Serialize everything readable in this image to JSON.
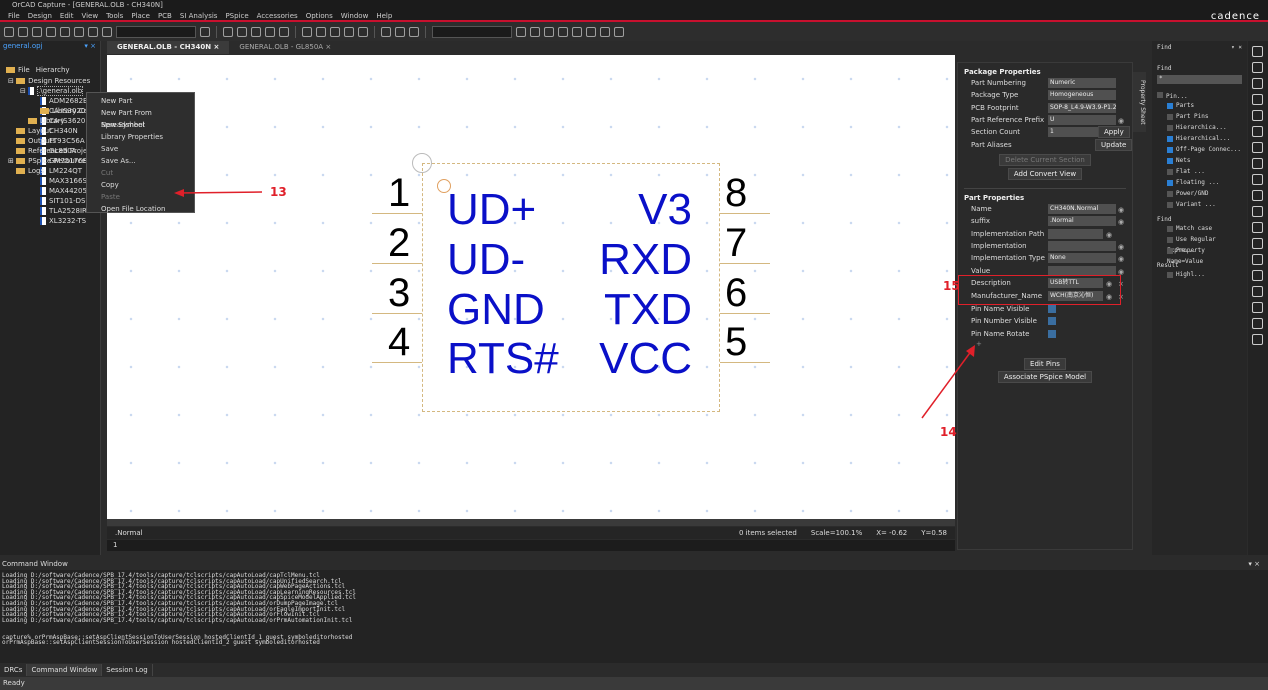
{
  "window": {
    "title": "OrCAD Capture - [GENERAL.OLB - CH340N]",
    "brand": "cadence"
  },
  "menu": [
    "File",
    "Design",
    "Edit",
    "View",
    "Tools",
    "Place",
    "PCB",
    "SI Analysis",
    "PSpice",
    "Accessories",
    "Options",
    "Window",
    "Help"
  ],
  "project_panel": {
    "title": "general.opj",
    "tabs": [
      "File",
      "Hierarchy"
    ],
    "tree": {
      "design_resources": "Design Resources",
      "library_file": ".\\general.olb",
      "parts": [
        "ADM2682EI",
        "CA-IS3020S",
        "CA-IS3620L",
        "CH340N",
        "FT93C56A",
        "GL850A",
        "GM75176E",
        "LM224QT",
        "MAX3166S",
        "MAX44205I",
        "SIT101-DS-",
        "TLA2528IRT",
        "XL3232-TS"
      ],
      "library_cache": "Library Cache",
      "library": "Library",
      "others": [
        "Layout",
        "Outputs",
        "Referenced Projects",
        "PSpice Resources",
        "Logs"
      ]
    }
  },
  "context_menu": {
    "items": [
      {
        "label": "New Part",
        "enabled": true
      },
      {
        "label": "New Part From Spreadsheet",
        "enabled": true
      },
      {
        "label": "New Symbol",
        "enabled": true
      },
      {
        "label": "Library Properties",
        "enabled": true
      },
      {
        "label": "Save",
        "enabled": true
      },
      {
        "label": "Save As...",
        "enabled": true
      },
      {
        "label": "Cut",
        "enabled": false
      },
      {
        "label": "Copy",
        "enabled": true
      },
      {
        "label": "Paste",
        "enabled": false
      },
      {
        "label": "Open File Location",
        "enabled": true
      }
    ]
  },
  "doc_tabs": [
    {
      "label": "GENERAL.OLB - CH340N",
      "active": true
    },
    {
      "label": "GENERAL.OLB - GL850A",
      "active": false
    }
  ],
  "symbol": {
    "left_pins": [
      {
        "num": "1",
        "name": "UD+"
      },
      {
        "num": "2",
        "name": "UD-"
      },
      {
        "num": "3",
        "name": "GND"
      },
      {
        "num": "4",
        "name": "RTS#"
      }
    ],
    "right_pins": [
      {
        "num": "8",
        "name": "V3"
      },
      {
        "num": "7",
        "name": "RXD"
      },
      {
        "num": "6",
        "name": "TXD"
      },
      {
        "num": "5",
        "name": "VCC"
      }
    ]
  },
  "canvas_status": {
    "left": ".Normal",
    "selected": "0 items selected",
    "scale": "Scale=100.1%",
    "x": "X= -0.62",
    "y": "Y=0.58",
    "cmd": "1"
  },
  "property_sheet": {
    "tab": "Property Sheet",
    "package_title": "Package Properties",
    "package": [
      {
        "label": "Part Numbering",
        "value": "Numeric"
      },
      {
        "label": "Package Type",
        "value": "Homogeneous"
      },
      {
        "label": "PCB Footprint",
        "value": "SOP-8_L4.9-W3.9-P1.27-LS6."
      },
      {
        "label": "Part Reference Prefix",
        "value": "U"
      },
      {
        "label": "Section Count",
        "value": "1"
      },
      {
        "label": "Part Aliases",
        "value": ""
      }
    ],
    "apply": "Apply",
    "update": "Update",
    "delete_section": "Delete Current Section",
    "add_convert": "Add Convert View",
    "part_title": "Part Properties",
    "part": [
      {
        "label": "Name",
        "value": "CH340N.Normal"
      },
      {
        "label": "suffix",
        "value": ".Normal"
      },
      {
        "label": "Implementation Path",
        "value": ""
      },
      {
        "label": "Implementation",
        "value": ""
      },
      {
        "label": "Implementation Type",
        "value": "None"
      },
      {
        "label": "Value",
        "value": ""
      },
      {
        "label": "Description",
        "value": "USB转TTL"
      },
      {
        "label": "Manufacturer_Name",
        "value": "WCH(南京沁恒)"
      }
    ],
    "checks": [
      {
        "label": "Pin Name Visible",
        "checked": true
      },
      {
        "label": "Pin Number Visible",
        "checked": true
      },
      {
        "label": "Pin Name Rotate",
        "checked": true
      }
    ],
    "add_icon": "plus-icon",
    "edit_pins": "Edit Pins",
    "assoc_pspice": "Associate PSpice Model"
  },
  "find": {
    "title": "Find",
    "find_label": "Find",
    "input": "*",
    "group": "Pin...",
    "items": [
      {
        "label": "Parts",
        "checked": true
      },
      {
        "label": "Part Pins",
        "checked": false
      },
      {
        "label": "Hierarchica...",
        "checked": false
      },
      {
        "label": "Hierarchical...",
        "checked": true
      },
      {
        "label": "Off-Page Connec...",
        "checked": true
      },
      {
        "label": "Nets",
        "checked": true
      },
      {
        "label": "Flat ...",
        "checked": false
      },
      {
        "label": "Floating ...",
        "checked": true
      },
      {
        "label": "Power/GND",
        "checked": false
      },
      {
        "label": "Variant ...",
        "checked": false
      }
    ],
    "opts_title": "Find",
    "opts": [
      "Match case",
      "Use Regular Expre...",
      "Property Name=Value"
    ],
    "result_title": "Result",
    "result": "Highl..."
  },
  "command_window": {
    "title": "Command Window",
    "lines": [
      "Loading D:/software/Cadence/SPB_17.4/tools/capture/tclscripts/capAutoLoad/capTclMenu.tcl",
      "Loading D:/software/Cadence/SPB_17.4/tools/capture/tclscripts/capAutoLoad/capUnifiedSearch.tcl",
      "Loading D:/software/Cadence/SPB_17.4/tools/capture/tclscripts/capAutoLoad/capWebPageActions.tcl",
      "Loading D:/software/Cadence/SPB_17.4/tools/capture/tclscripts/capAutoLoad/capLearningResources.tcl",
      "Loading D:/software/Cadence/SPB_17.4/tools/capture/tclscripts/capAutoLoad/capSpiceModelApplied.tcl",
      "Loading D:/software/Cadence/SPB_17.4/tools/capture/tclscripts/capAutoLoad/orDumpPageImage.tcl",
      "Loading D:/software/Cadence/SPB_17.4/tools/capture/tclscripts/capAutoLoad/orEagleImportInit.tcl",
      "Loading D:/software/Cadence/SPB_17.4/tools/capture/tclscripts/capAutoLoad/orFlowInit.tcl",
      "Loading D:/software/Cadence/SPB_17.4/tools/capture/tclscripts/capAutoLoad/orPrmAutomationInit.tcl",
      "",
      "",
      "capture% orPrmAspBase::setAspClientSessionToUserSession hostedClientId_1 guest symboleditorhosted",
      "orPrmAspBase::setAspClientSessionToUserSession hostedClientId_2 guest symboleditorhosted"
    ]
  },
  "bottom_tabs": [
    "DRCs",
    "Command Window",
    "Session Log"
  ],
  "status": "Ready",
  "annotations": [
    "13",
    "14",
    "15"
  ],
  "colors": {
    "accent": "#c8102e",
    "pin_name": "#0a10c8",
    "annotation": "#e0202a"
  }
}
